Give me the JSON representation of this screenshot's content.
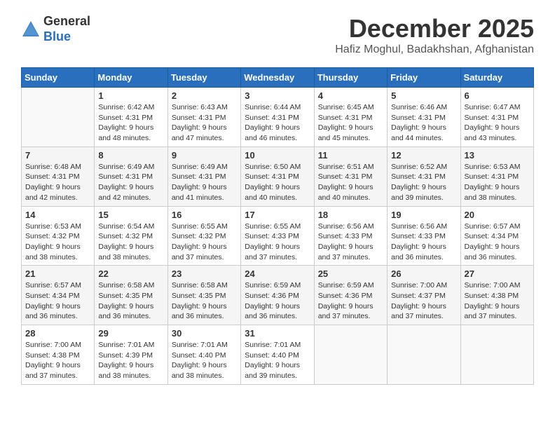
{
  "header": {
    "logo_line1": "General",
    "logo_line2": "Blue",
    "month": "December 2025",
    "location": "Hafiz Moghul, Badakhshan, Afghanistan"
  },
  "weekdays": [
    "Sunday",
    "Monday",
    "Tuesday",
    "Wednesday",
    "Thursday",
    "Friday",
    "Saturday"
  ],
  "weeks": [
    [
      {
        "day": "",
        "info": ""
      },
      {
        "day": "1",
        "info": "Sunrise: 6:42 AM\nSunset: 4:31 PM\nDaylight: 9 hours\nand 48 minutes."
      },
      {
        "day": "2",
        "info": "Sunrise: 6:43 AM\nSunset: 4:31 PM\nDaylight: 9 hours\nand 47 minutes."
      },
      {
        "day": "3",
        "info": "Sunrise: 6:44 AM\nSunset: 4:31 PM\nDaylight: 9 hours\nand 46 minutes."
      },
      {
        "day": "4",
        "info": "Sunrise: 6:45 AM\nSunset: 4:31 PM\nDaylight: 9 hours\nand 45 minutes."
      },
      {
        "day": "5",
        "info": "Sunrise: 6:46 AM\nSunset: 4:31 PM\nDaylight: 9 hours\nand 44 minutes."
      },
      {
        "day": "6",
        "info": "Sunrise: 6:47 AM\nSunset: 4:31 PM\nDaylight: 9 hours\nand 43 minutes."
      }
    ],
    [
      {
        "day": "7",
        "info": "Sunrise: 6:48 AM\nSunset: 4:31 PM\nDaylight: 9 hours\nand 42 minutes."
      },
      {
        "day": "8",
        "info": "Sunrise: 6:49 AM\nSunset: 4:31 PM\nDaylight: 9 hours\nand 42 minutes."
      },
      {
        "day": "9",
        "info": "Sunrise: 6:49 AM\nSunset: 4:31 PM\nDaylight: 9 hours\nand 41 minutes."
      },
      {
        "day": "10",
        "info": "Sunrise: 6:50 AM\nSunset: 4:31 PM\nDaylight: 9 hours\nand 40 minutes."
      },
      {
        "day": "11",
        "info": "Sunrise: 6:51 AM\nSunset: 4:31 PM\nDaylight: 9 hours\nand 40 minutes."
      },
      {
        "day": "12",
        "info": "Sunrise: 6:52 AM\nSunset: 4:31 PM\nDaylight: 9 hours\nand 39 minutes."
      },
      {
        "day": "13",
        "info": "Sunrise: 6:53 AM\nSunset: 4:31 PM\nDaylight: 9 hours\nand 38 minutes."
      }
    ],
    [
      {
        "day": "14",
        "info": "Sunrise: 6:53 AM\nSunset: 4:32 PM\nDaylight: 9 hours\nand 38 minutes."
      },
      {
        "day": "15",
        "info": "Sunrise: 6:54 AM\nSunset: 4:32 PM\nDaylight: 9 hours\nand 38 minutes."
      },
      {
        "day": "16",
        "info": "Sunrise: 6:55 AM\nSunset: 4:32 PM\nDaylight: 9 hours\nand 37 minutes."
      },
      {
        "day": "17",
        "info": "Sunrise: 6:55 AM\nSunset: 4:33 PM\nDaylight: 9 hours\nand 37 minutes."
      },
      {
        "day": "18",
        "info": "Sunrise: 6:56 AM\nSunset: 4:33 PM\nDaylight: 9 hours\nand 37 minutes."
      },
      {
        "day": "19",
        "info": "Sunrise: 6:56 AM\nSunset: 4:33 PM\nDaylight: 9 hours\nand 36 minutes."
      },
      {
        "day": "20",
        "info": "Sunrise: 6:57 AM\nSunset: 4:34 PM\nDaylight: 9 hours\nand 36 minutes."
      }
    ],
    [
      {
        "day": "21",
        "info": "Sunrise: 6:57 AM\nSunset: 4:34 PM\nDaylight: 9 hours\nand 36 minutes."
      },
      {
        "day": "22",
        "info": "Sunrise: 6:58 AM\nSunset: 4:35 PM\nDaylight: 9 hours\nand 36 minutes."
      },
      {
        "day": "23",
        "info": "Sunrise: 6:58 AM\nSunset: 4:35 PM\nDaylight: 9 hours\nand 36 minutes."
      },
      {
        "day": "24",
        "info": "Sunrise: 6:59 AM\nSunset: 4:36 PM\nDaylight: 9 hours\nand 36 minutes."
      },
      {
        "day": "25",
        "info": "Sunrise: 6:59 AM\nSunset: 4:36 PM\nDaylight: 9 hours\nand 37 minutes."
      },
      {
        "day": "26",
        "info": "Sunrise: 7:00 AM\nSunset: 4:37 PM\nDaylight: 9 hours\nand 37 minutes."
      },
      {
        "day": "27",
        "info": "Sunrise: 7:00 AM\nSunset: 4:38 PM\nDaylight: 9 hours\nand 37 minutes."
      }
    ],
    [
      {
        "day": "28",
        "info": "Sunrise: 7:00 AM\nSunset: 4:38 PM\nDaylight: 9 hours\nand 37 minutes."
      },
      {
        "day": "29",
        "info": "Sunrise: 7:01 AM\nSunset: 4:39 PM\nDaylight: 9 hours\nand 38 minutes."
      },
      {
        "day": "30",
        "info": "Sunrise: 7:01 AM\nSunset: 4:40 PM\nDaylight: 9 hours\nand 38 minutes."
      },
      {
        "day": "31",
        "info": "Sunrise: 7:01 AM\nSunset: 4:40 PM\nDaylight: 9 hours\nand 39 minutes."
      },
      {
        "day": "",
        "info": ""
      },
      {
        "day": "",
        "info": ""
      },
      {
        "day": "",
        "info": ""
      }
    ]
  ]
}
